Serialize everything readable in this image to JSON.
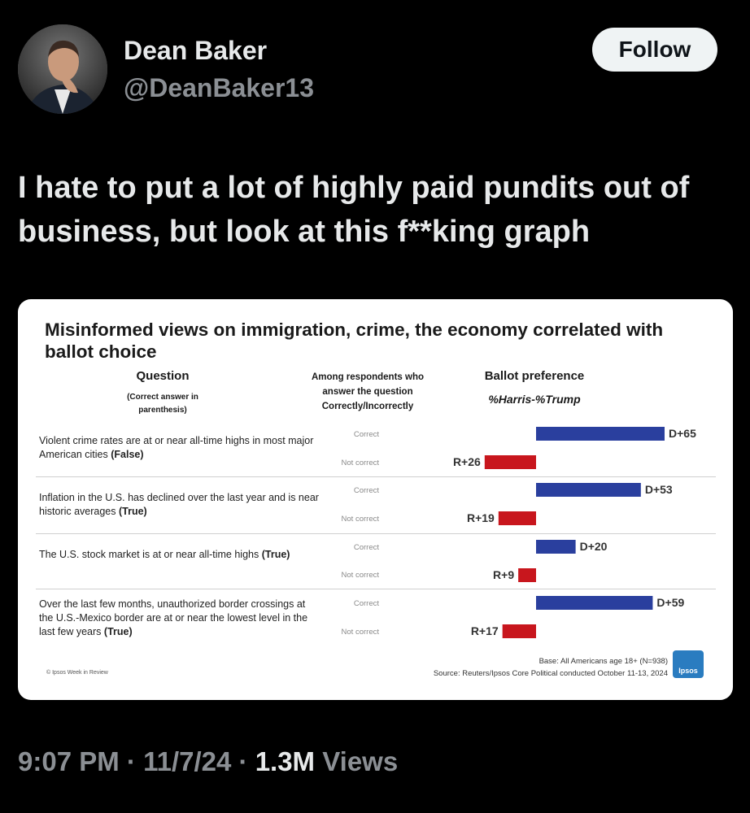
{
  "tweet": {
    "author_name": "Dean Baker",
    "author_handle": "@DeanBaker13",
    "follow_label": "Follow",
    "text": "I hate to put a lot of highly paid pundits out of business, but look at this f**king graph",
    "time": "9:07 PM",
    "date": "11/7/24",
    "views_count": "1.3M",
    "views_label": "Views",
    "dot": "·"
  },
  "chart_data": {
    "type": "bar",
    "title": "Misinformed views on immigration, crime, the economy correlated with ballot choice",
    "column_headers": {
      "question": "Question",
      "question_note": "(Correct answer in parenthesis)",
      "among": "Among respondents who answer the question Correctly/Incorrectly",
      "ballot": "Ballot preference",
      "ballot_sub": "%Harris-%Trump"
    },
    "questions": [
      {
        "text": "Violent crime rates are at or near all-time highs in most major American cities",
        "answer": "(False)"
      },
      {
        "text": "Inflation in the U.S. has declined over the last year and is near historic averages",
        "answer": "(True)"
      },
      {
        "text": "The U.S. stock market is at or near all-time highs",
        "answer": "(True)"
      },
      {
        "text": "Over the last few months, unauthorized border crossings at the U.S.-Mexico border are at or near the lowest level in the last few years",
        "answer": "(True)"
      }
    ],
    "row_labels": [
      "Correct",
      "Not correct"
    ],
    "series": [
      {
        "name": "Correct",
        "color": "#2a3f9e",
        "values": [
          65,
          53,
          20,
          59
        ],
        "labels": [
          "D+65",
          "D+53",
          "D+20",
          "D+59"
        ]
      },
      {
        "name": "Not correct",
        "color": "#c8161d",
        "values": [
          -26,
          -19,
          -9,
          -17
        ],
        "labels": [
          "R+26",
          "R+19",
          "R+9",
          "R+17"
        ]
      }
    ],
    "base_note": "Base: All Americans age 18+ (N=938)",
    "source": "Source: Reuters/Ipsos Core Political conducted October 11-13, 2024",
    "credit": "© Ipsos Week in Review",
    "logo_text": "Ipsos"
  }
}
